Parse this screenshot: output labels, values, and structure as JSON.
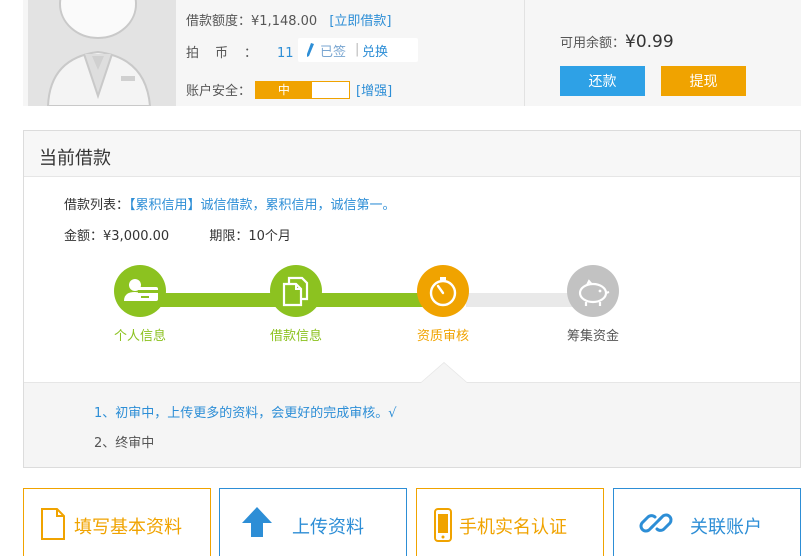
{
  "account": {
    "loan_quota_label": "借款额度：",
    "loan_quota_value": "¥1,148.00",
    "borrow_now_open": "[",
    "borrow_now": "立即借款",
    "borrow_now_close": "]",
    "coins_label": "拍币：",
    "coins_value": "11",
    "signed_label": "已签",
    "separator": "|",
    "exchange_label": "兑换",
    "security_label": "账户安全：",
    "security_level": "中",
    "security_fraction": 0.6,
    "enhance_label": "[增强]",
    "balance_label": "可用余额：",
    "balance_value": "¥0.99",
    "repay_button": "还款",
    "withdraw_button": "提现"
  },
  "loan": {
    "title": "当前借款",
    "list_label": "借款列表：",
    "list_value": "【累积信用】诚信借款，累积信用，诚信第一。",
    "amount_label": "金额：",
    "amount_value": "¥3,000.00",
    "term_label": "期限：",
    "term_value": "10个月",
    "steps": [
      {
        "label": "个人信息",
        "icon": "id-card-icon",
        "status": "done"
      },
      {
        "label": "借款信息",
        "icon": "documents-icon",
        "status": "done"
      },
      {
        "label": "资质审核",
        "icon": "stopwatch-icon",
        "status": "current"
      },
      {
        "label": "筹集资金",
        "icon": "piggy-bank-icon",
        "status": "pending"
      }
    ],
    "notes": [
      "1、初审中，上传更多的资料，会更好的完成审核。√",
      "2、终审中"
    ]
  },
  "actions": [
    {
      "label": "填写基本资料",
      "icon": "document-icon",
      "color": "#f0a300"
    },
    {
      "label": "上传资料",
      "icon": "upload-arrow-icon",
      "color": "#2d8ed6"
    },
    {
      "label": "手机实名认证",
      "icon": "mobile-phone-icon",
      "color": "#f0a300"
    },
    {
      "label": "关联账户",
      "icon": "link-icon",
      "color": "#2d8ed6"
    }
  ],
  "colors": {
    "green": "#8cc220",
    "orange": "#f0a300",
    "blue": "#2d8ed6",
    "gray": "#c2c2c2"
  }
}
